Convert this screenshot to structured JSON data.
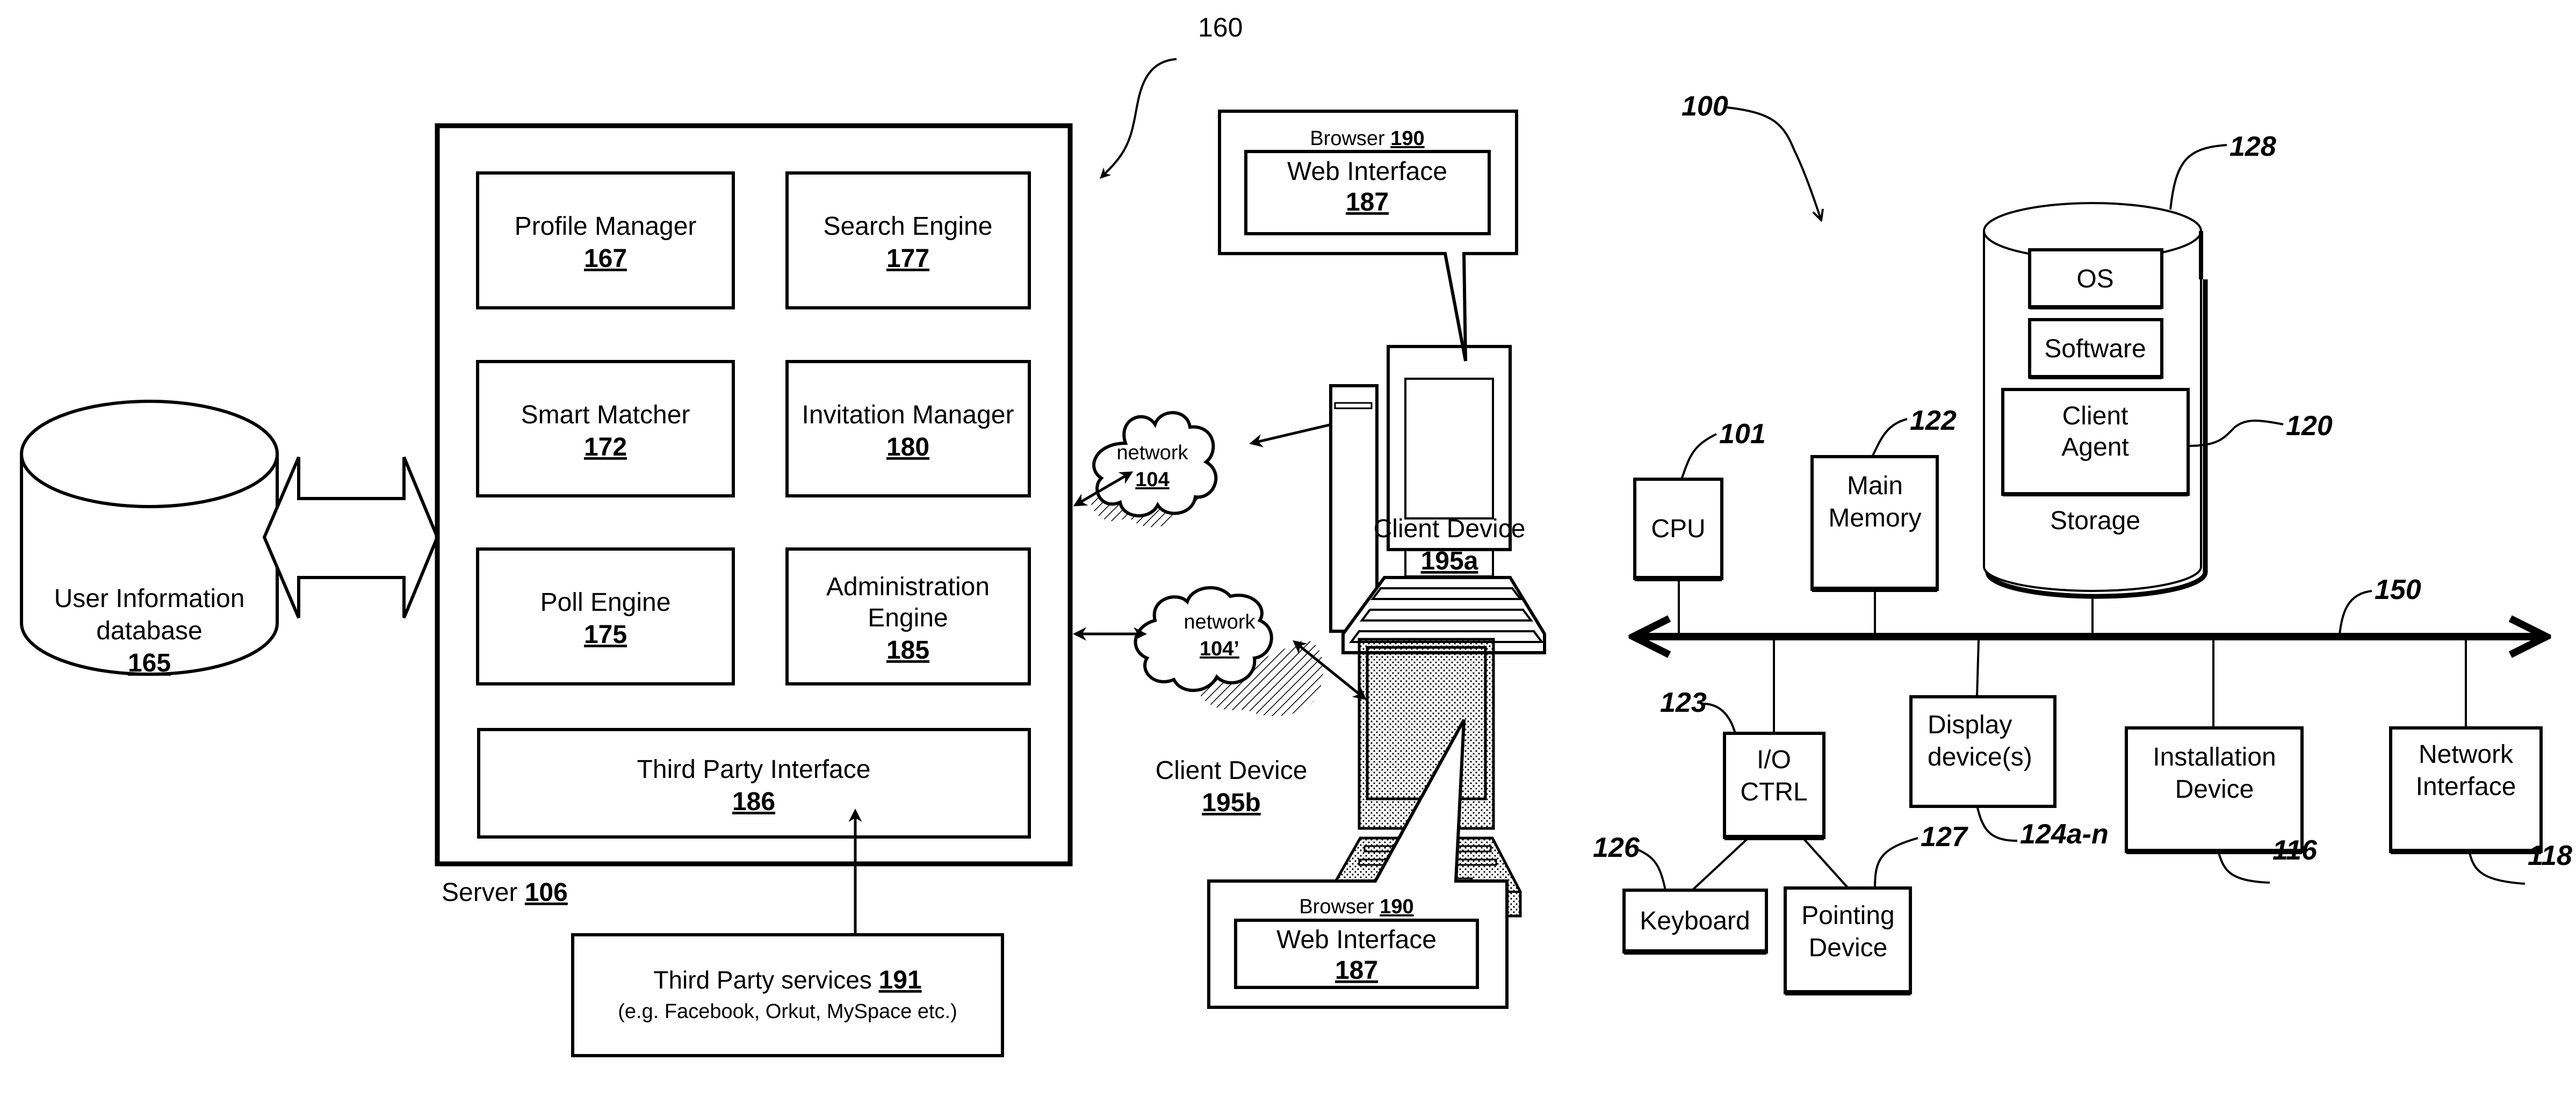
{
  "figure_left": {
    "ref": "160",
    "server": {
      "label": "Server",
      "num": "106"
    },
    "modules": [
      {
        "label": "Profile Manager",
        "num": "167"
      },
      {
        "label": "Search Engine",
        "num": "177"
      },
      {
        "label": "Smart Matcher",
        "num": "172"
      },
      {
        "label": "Invitation Manager",
        "num": "180"
      },
      {
        "label": "Poll Engine",
        "num": "175"
      },
      {
        "label_line1": "Administration",
        "label_line2": "Engine",
        "num": "185"
      },
      {
        "label": "Third Party Interface",
        "num": "186"
      }
    ],
    "database": {
      "line1": "User Information",
      "line2": "database",
      "num": "165"
    },
    "third_party": {
      "label": "Third Party services",
      "num": "191",
      "examples": "(e.g. Facebook, Orkut, MySpace etc.)"
    },
    "networks": [
      {
        "label": "network",
        "num": "104"
      },
      {
        "label": "network",
        "num": "104’"
      }
    ],
    "clients": [
      {
        "label": "Client Device",
        "num": "195a",
        "browser_label": "Browser",
        "browser_num": "190",
        "web_label": "Web Interface",
        "web_num": "187"
      },
      {
        "label": "Client Device",
        "num": "195b",
        "browser_label": "Browser",
        "browser_num": "190",
        "web_label": "Web Interface",
        "web_num": "187"
      }
    ]
  },
  "figure_right": {
    "ref": "100",
    "bus_ref": "150",
    "storage": {
      "label": "Storage",
      "ref": "128",
      "items": [
        "OS",
        "Software"
      ],
      "agent_line1": "Client",
      "agent_line2": "Agent",
      "agent_ref": "120"
    },
    "cpu": {
      "label": "CPU",
      "ref": "101"
    },
    "memory": {
      "line1": "Main",
      "line2": "Memory",
      "ref": "122"
    },
    "io": {
      "line1": "I/O",
      "line2": "CTRL",
      "ref": "123"
    },
    "display": {
      "line1": "Display",
      "line2": "device(s)",
      "ref": "124a-n"
    },
    "keyboard": {
      "label": "Keyboard",
      "ref": "126"
    },
    "pointing": {
      "line1": "Pointing",
      "line2": "Device",
      "ref": "127"
    },
    "installation": {
      "line1": "Installation",
      "line2": "Device",
      "ref": "116"
    },
    "network_interface": {
      "line1": "Network",
      "line2": "Interface",
      "ref": "118"
    }
  }
}
